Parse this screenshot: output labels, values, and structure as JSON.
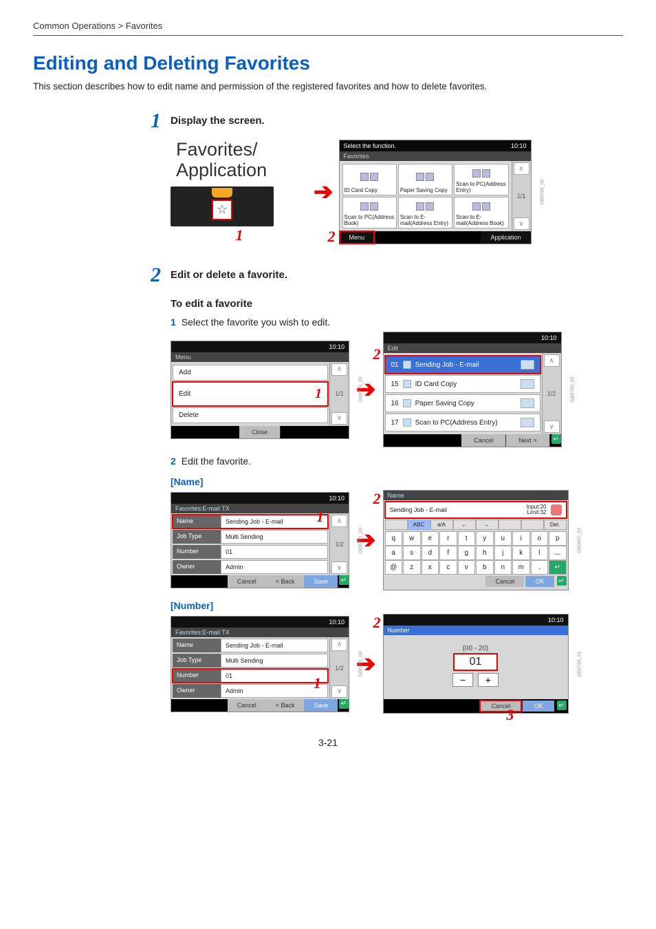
{
  "breadcrumb": "Common Operations > Favorites",
  "page_title": "Editing and Deleting Favorites",
  "intro": "This section describes how to edit name and permission of the registered favorites and how to delete favorites.",
  "step1": {
    "title": "Display the screen.",
    "favapp1": "Favorites/",
    "favapp2": "Application",
    "callout_1": "1",
    "callout_2": "2",
    "panel": {
      "titlebar_left": "Select the function.",
      "titlebar_right": "10:10",
      "subbar": "Favorites",
      "tiles": [
        "ID Card Copy",
        "Paper Saving Copy",
        "Scan to PC(Address Entry)",
        "Scan to PC(Address Book)",
        "Scan to E-mail(Address Entry)",
        "Scan to E-mail(Address Book)"
      ],
      "page_ind": "1/1",
      "menu_btn": "Menu",
      "app_btn": "Application",
      "side_id": "GB0096_00"
    }
  },
  "step2": {
    "title": "Edit or delete a favorite.",
    "subheading": "To edit a favorite",
    "sub1": {
      "n": "1",
      "t": "Select the favorite you wish to edit."
    },
    "sub2": {
      "n": "2",
      "t": "Edit the favorite."
    },
    "menu_panel": {
      "titlebar_right": "10:10",
      "subbar": "Menu",
      "items": [
        "Add",
        "Edit",
        "Delete"
      ],
      "page_ind": "1/1",
      "close": "Close",
      "side_id": "GB0779_00",
      "callout": "1"
    },
    "edit_panel": {
      "titlebar_right": "10:10",
      "subbar": "Edit",
      "rows": [
        {
          "n": "01",
          "t": "Sending Job - E-mail",
          "sel": true
        },
        {
          "n": "15",
          "t": "ID Card Copy"
        },
        {
          "n": "16",
          "t": "Paper Saving Copy"
        },
        {
          "n": "17",
          "t": "Scan to PC(Address Entry)"
        }
      ],
      "page_ind": "1/2",
      "cancel": "Cancel",
      "next": "Next >",
      "side_id": "GB0780_00",
      "callout": "2"
    },
    "name_label": "[Name]",
    "number_label": "[Number]",
    "prop_panel": {
      "titlebar_right": "10:10",
      "subbar": "Favorites:E-mail TX",
      "rows": [
        {
          "lab": "Name",
          "val": "Sending Job - E-mail"
        },
        {
          "lab": "Job Type",
          "val": "Multi Sending"
        },
        {
          "lab": "Number",
          "val": "01"
        },
        {
          "lab": "Owner",
          "val": "Admin"
        }
      ],
      "page_ind": "1/2",
      "cancel": "Cancel",
      "back": "< Back",
      "save": "Save",
      "side_id": "GB0781_00"
    },
    "kb_panel": {
      "subbar": "Name",
      "input_value": "Sending Job - E-mail",
      "limit_top": "Input:20",
      "limit_bot": "Limit:32",
      "modes": [
        "",
        "ABC",
        "a/A",
        "←",
        "→",
        "",
        "",
        "Del."
      ],
      "keys_r1": [
        "q",
        "w",
        "e",
        "r",
        "t",
        "y",
        "u",
        "i",
        "o",
        "p"
      ],
      "keys_r2": [
        "a",
        "s",
        "d",
        "f",
        "g",
        "h",
        "j",
        "k",
        "l",
        "⌴"
      ],
      "keys_r3": [
        "@",
        "z",
        "x",
        "c",
        "v",
        "b",
        "n",
        "m",
        ".",
        "↵"
      ],
      "cancel": "Cancel",
      "ok": "OK",
      "side_id": "GB0057_02",
      "callout": "2"
    },
    "num_panel": {
      "titlebar_right": "10:10",
      "subbar": "Number",
      "range": "(00 - 20)",
      "value": "01",
      "cancel": "Cancel",
      "ok": "OK",
      "side_id": "GB0760_01",
      "callout_2": "2",
      "callout_3": "3"
    },
    "prop_callout_name": "1",
    "prop_callout_num": "1"
  },
  "page_number": "3-21"
}
